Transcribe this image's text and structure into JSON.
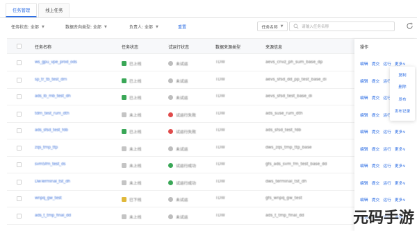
{
  "tabs": [
    {
      "label": "任务管理",
      "active": true
    },
    {
      "label": "线上任务",
      "active": false
    }
  ],
  "filters": {
    "task_status": "任务状态: 全部",
    "data_source_type": "数据去向类型: 全部",
    "owner": "负责人: 全部",
    "reset": "重置"
  },
  "search": {
    "field": "任务名称",
    "placeholder": "请输入任务名称"
  },
  "table": {
    "headers": {
      "name": "任务名称",
      "status": "任务状态",
      "trial": "试运行状态",
      "data_type": "数据来源类型",
      "source": "来源信息",
      "ops": "操作"
    },
    "rows": [
      {
        "name": "ws_gpu_vpe_prod_ods",
        "status": "已上线",
        "status_color": "#3aa757",
        "trial": "未试运",
        "trial_color": "#bdbdbd",
        "data_type": "TDW",
        "source": "aevs_cnvz_ph_sum_base_dp"
      },
      {
        "name": "sp_tr_tb_test_dm",
        "status": "已上线",
        "status_color": "#3aa757",
        "trial": "未试运",
        "trial_color": "#bdbdbd",
        "data_type": "TDW",
        "source": "aevs_sfsd_dd_pp_test_base_di"
      },
      {
        "name": "ads_lb_mb_test_dh",
        "status": "已上线",
        "status_color": "#3aa757",
        "trial": "未试运",
        "trial_color": "#bdbdbd",
        "data_type": "TDW",
        "source": "aevs_sfsd_test_base_di"
      },
      {
        "name": "tdm_test_rum_dth",
        "status": "未上线",
        "status_color": "#c4c4c4",
        "trial": "试运行失败",
        "trial_color": "#e04b4b",
        "data_type": "TDW",
        "source": "ads_suse_rum_dth"
      },
      {
        "name": "ads_sfsd_test_fdb",
        "status": "已上线",
        "status_color": "#3aa757",
        "trial": "试运行失败",
        "trial_color": "#e04b4b",
        "data_type": "TDW",
        "source": "ads_sfsd_test_fdb"
      },
      {
        "name": "zqs_tmp_ttp",
        "status": "未上线",
        "status_color": "#c4c4c4",
        "trial": "未试运",
        "trial_color": "#bdbdbd",
        "data_type": "TDW",
        "source": "dws_zqs_tmp_ttp_base"
      },
      {
        "name": "svmSfm_test_ds",
        "status": "未上线",
        "status_color": "#c4c4c4",
        "trial": "试运行成功",
        "trial_color": "#3aa757",
        "data_type": "TDW",
        "source": "gfs_ads_svm_fm_test_base_dd"
      },
      {
        "name": "DwTerminal_tst_dh",
        "status": "未上线",
        "status_color": "#c4c4c4",
        "trial": "试运行成功",
        "trial_color": "#3aa757",
        "data_type": "TDW",
        "source": "dws_terminal_tst_dh"
      },
      {
        "name": "wnpq_gw_test",
        "status": "已下线",
        "status_color": "#e0b83a",
        "trial": "未试运",
        "trial_color": "#bdbdbd",
        "data_type": "TDW",
        "source": "gfs_wnpq_gw_test"
      },
      {
        "name": "ads_t_tmp_final_dd",
        "status": "未上线",
        "status_color": "#c4c4c4",
        "trial": "未试运",
        "trial_color": "#bdbdbd",
        "data_type": "TDW",
        "source": "ads_t_tmp_final_dd"
      }
    ],
    "actions": {
      "edit": "编辑",
      "submit": "提交",
      "run": "运行",
      "more": "更多∨"
    }
  },
  "more_menu": [
    "复制",
    "删除",
    "发布",
    "发布记录"
  ],
  "watermark": "元码手游网",
  "colors": {
    "primary": "#2f6fe4"
  }
}
